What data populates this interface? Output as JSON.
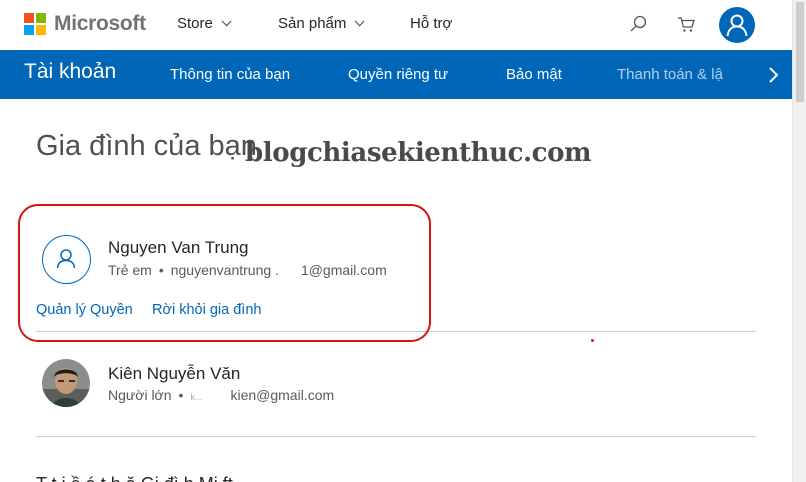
{
  "header": {
    "brand": "Microsoft",
    "nav": [
      {
        "label": "Store"
      },
      {
        "label": "Sản phẩm"
      },
      {
        "label": "Hỗ trợ"
      }
    ],
    "icons": [
      "search-icon",
      "cart-icon",
      "account-icon"
    ]
  },
  "account_nav": {
    "title": "Tài khoản",
    "links": [
      "Thông tin của bạn",
      "Quyền riêng tư",
      "Bảo mật",
      "Thanh toán & lậ"
    ]
  },
  "main": {
    "title": "Gia đình của bạn",
    "watermark": "blogchiasekienthuc.com",
    "members": [
      {
        "name": "Nguyen Van Trung",
        "role": "Trẻ em",
        "email_part1": "nguyenvantrung .",
        "email_part2": "1@gmail.com",
        "actions": [
          "Quản lý Quyền",
          "Rời khỏi gia đình"
        ]
      },
      {
        "name": "Kiên Nguyễn Văn",
        "role": "Người lớn",
        "email_part1": "k...",
        "email_part2": "kien@gmail.com"
      }
    ],
    "footer_partial": "T   t  i    ề    á    t   h   ă   Gi  đì h Mi      ft"
  },
  "colors": {
    "accent": "#0067b8",
    "highlight": "#d41414",
    "logo": [
      "#f25022",
      "#7fba00",
      "#00a4ef",
      "#ffb900"
    ]
  }
}
